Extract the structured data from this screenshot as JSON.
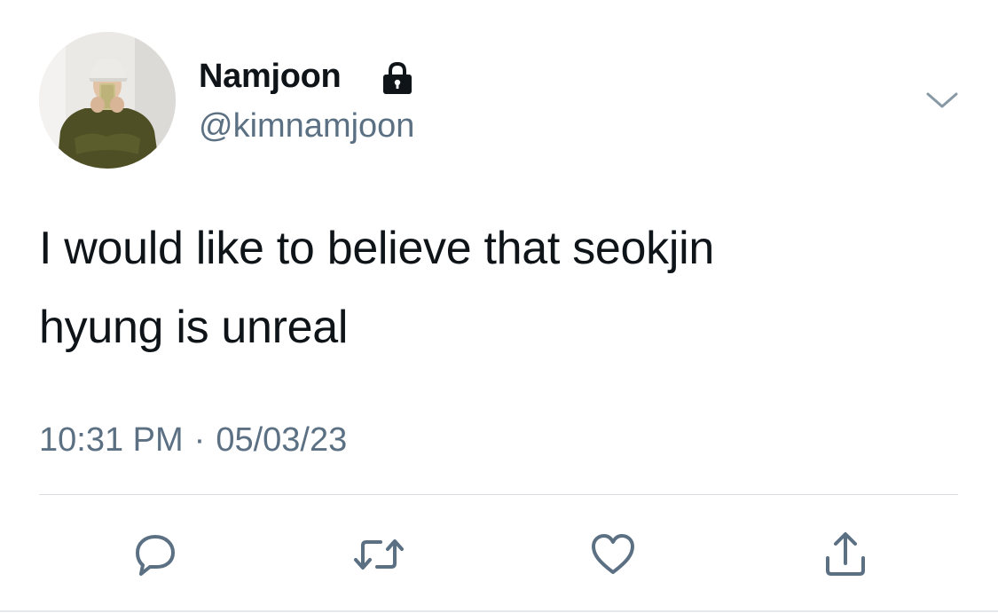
{
  "user": {
    "display_name": "Namjoon",
    "handle": "@kimnamjoon",
    "protected_icon": "lock-icon",
    "avatar": "profile-photo"
  },
  "tweet": {
    "line1": "I would like to believe that seokjin",
    "line2": "hyung is unreal",
    "time": "10:31 PM",
    "separator": "·",
    "date": "05/03/23"
  },
  "menu_icon": "chevron-down-icon",
  "actions": [
    {
      "icon": "reply-icon"
    },
    {
      "icon": "retweet-icon"
    },
    {
      "icon": "like-icon"
    },
    {
      "icon": "share-icon"
    }
  ],
  "colors": {
    "text": "#0f1419",
    "secondary": "#5b7083",
    "divider": "#d9dde2",
    "icon": "#5b7083"
  }
}
